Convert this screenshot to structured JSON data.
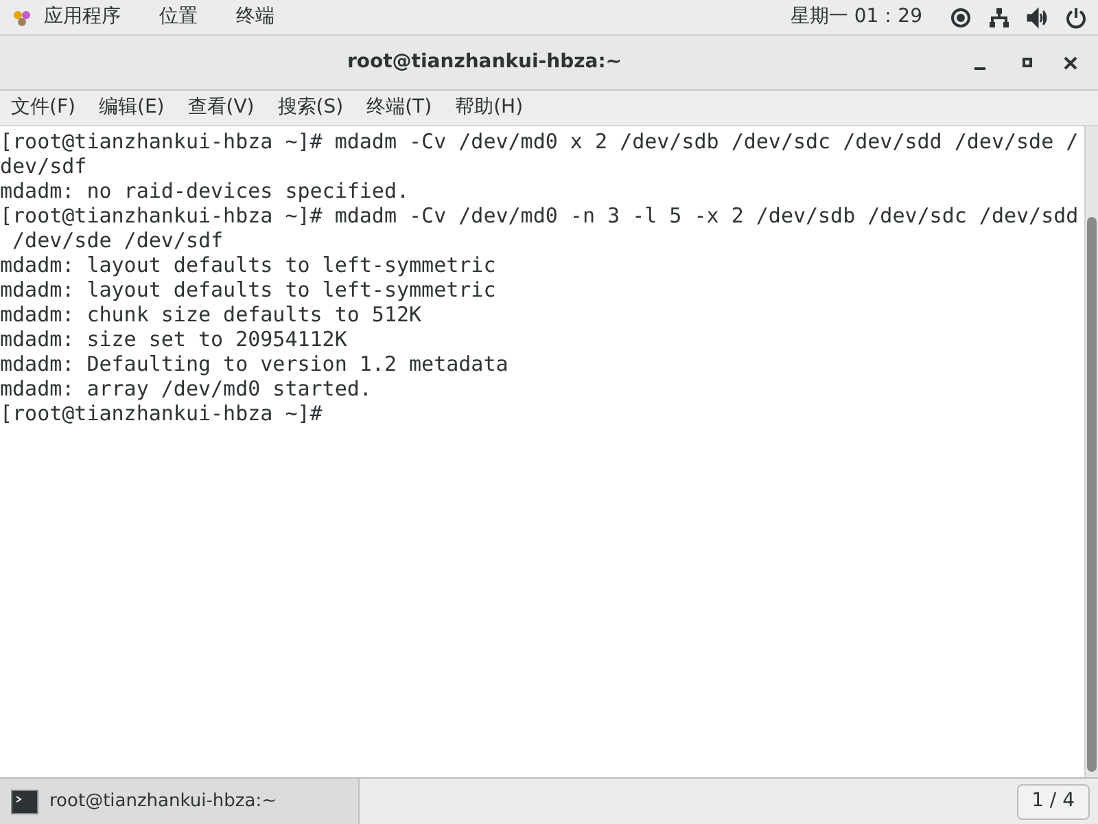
{
  "top_bar": {
    "menus": [
      "应用程序",
      "位置",
      "终端"
    ],
    "clock": "星期一 01：29"
  },
  "window": {
    "title": "root@tianzhankui-hbza:~"
  },
  "menu_bar": [
    "文件(F)",
    "编辑(E)",
    "查看(V)",
    "搜索(S)",
    "终端(T)",
    "帮助(H)"
  ],
  "terminal": {
    "lines": [
      "[root@tianzhankui-hbza ~]# mdadm -Cv /dev/md0 x 2 /dev/sdb /dev/sdc /dev/sdd /dev/sde /",
      "dev/sdf",
      "mdadm: no raid-devices specified.",
      "[root@tianzhankui-hbza ~]# mdadm -Cv /dev/md0 -n 3 -l 5 -x 2 /dev/sdb /dev/sdc /dev/sdd",
      " /dev/sde /dev/sdf",
      "mdadm: layout defaults to left-symmetric",
      "mdadm: layout defaults to left-symmetric",
      "mdadm: chunk size defaults to 512K",
      "mdadm: size set to 20954112K",
      "mdadm: Defaulting to version 1.2 metadata",
      "mdadm: array /dev/md0 started.",
      "[root@tianzhankui-hbza ~]#"
    ]
  },
  "taskbar": {
    "task": "root@tianzhankui-hbza:~",
    "workspace": "1 / 4"
  }
}
